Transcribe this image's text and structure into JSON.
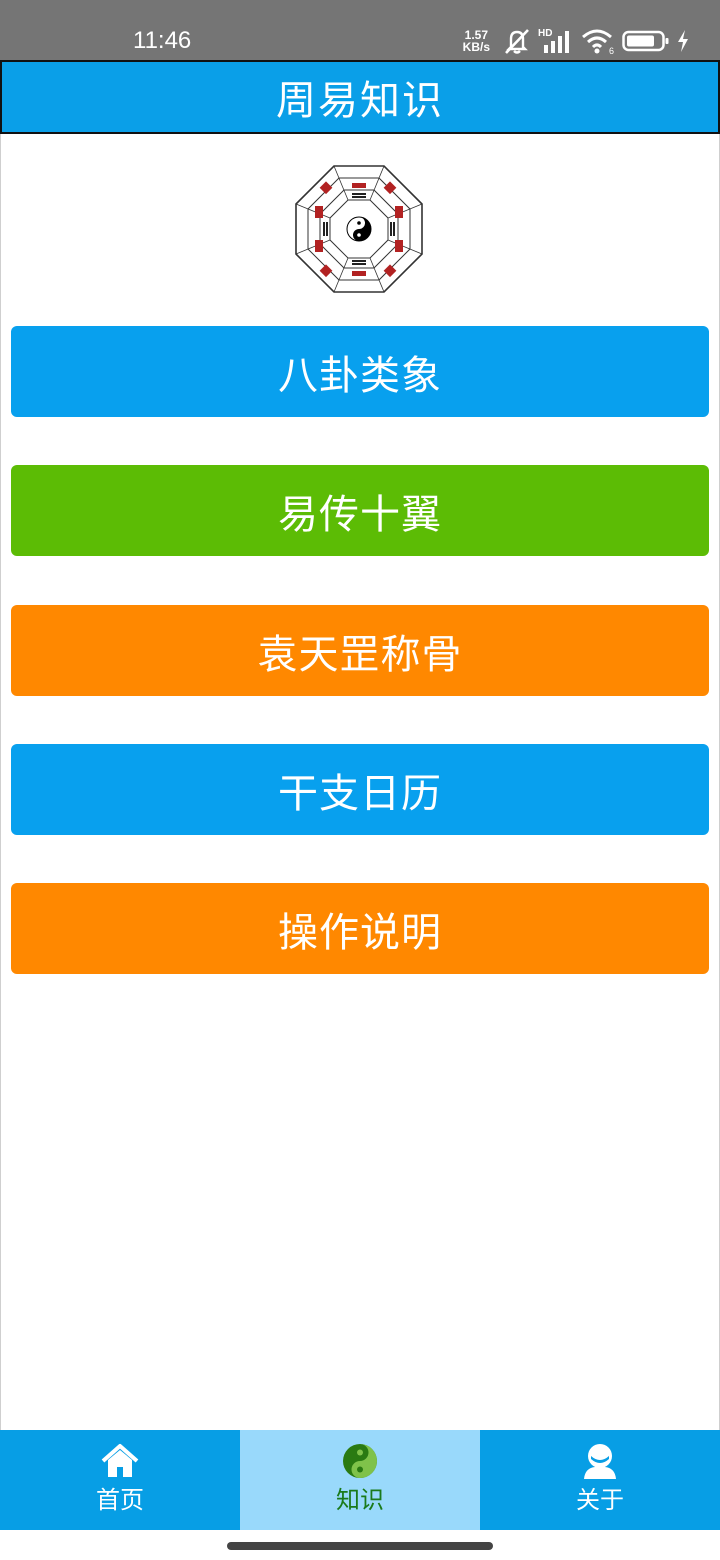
{
  "status_bar": {
    "time": "11:46",
    "net_speed_value": "1.57",
    "net_speed_unit": "KB/s",
    "signal_label": "HD",
    "wifi_label": "6",
    "icons": [
      "mute-icon",
      "signal-icon",
      "wifi-icon",
      "battery-icon",
      "charging-icon"
    ]
  },
  "header": {
    "title": "周易知识"
  },
  "menu": {
    "items": [
      {
        "label": "八卦类象",
        "color": "#08a0ee"
      },
      {
        "label": "易传十翼",
        "color": "#5cbc05"
      },
      {
        "label": "袁天罡称骨",
        "color": "#ff8800"
      },
      {
        "label": "干支日历",
        "color": "#08a0ee"
      },
      {
        "label": "操作说明",
        "color": "#ff8800"
      }
    ]
  },
  "bottom_nav": {
    "items": [
      {
        "label": "首页",
        "icon": "home-icon",
        "active": false
      },
      {
        "label": "知识",
        "icon": "yin-yang-icon",
        "active": true
      },
      {
        "label": "关于",
        "icon": "user-icon",
        "active": false
      }
    ]
  },
  "colors": {
    "primary": "#0a9fe8",
    "green": "#5cbc05",
    "orange": "#ff8800",
    "nav_active_bg": "#99d9fb",
    "nav_active_text": "#1a7a1a"
  }
}
